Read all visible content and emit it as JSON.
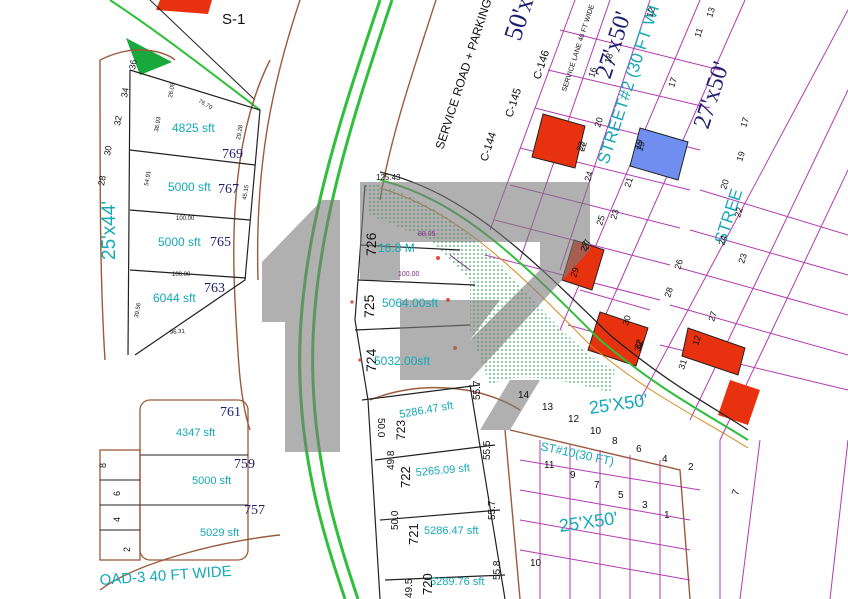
{
  "lots_left": [
    {
      "id": "769",
      "area": "4825 sft"
    },
    {
      "id": "767",
      "area": "5000 sft"
    },
    {
      "id": "765",
      "area": "5000 sft"
    },
    {
      "id": "763",
      "area": "6044 sft"
    }
  ],
  "lots_bottom_left": [
    {
      "id": "761",
      "area": "4347 sft"
    },
    {
      "id": "759",
      "area": "5000 sft"
    },
    {
      "id": "757",
      "area": "5029 sft"
    }
  ],
  "lots_center": [
    {
      "id": "726",
      "area": "16.8 M"
    },
    {
      "id": "725",
      "area": "5064.00sft"
    },
    {
      "id": "724",
      "area": "5032.00sft"
    },
    {
      "id": "723",
      "area": "5286.47 sft"
    },
    {
      "id": "722",
      "area": "5265.09 sft"
    },
    {
      "id": "721",
      "area": "5286.47 sft"
    },
    {
      "id": "720",
      "area": "5289.76 sft"
    }
  ],
  "dims_center": {
    "top": "125.43",
    "mid_a": "88.05",
    "mid_b": "100.00",
    "d1": "55.7",
    "d2": "55.5",
    "d3": "55.7",
    "d4": "55.8",
    "l1": "50.0",
    "l2": "49.8",
    "l3": "50.0",
    "l4": "49.5"
  },
  "dims_left": [
    "29.28",
    "26.09",
    "38.93",
    "54.91",
    "45.15",
    "100.00",
    "100.00",
    "96.31",
    "39.56",
    "76.70"
  ],
  "labels": {
    "s1": "S-1",
    "service_road": "SERVICE ROAD + PARKING",
    "service_lane": "SERVICE LANE 40 FT WIDE",
    "c144": "C-144",
    "c145": "C-145",
    "c146": "C-146",
    "size_top": "50'x",
    "size_27_a": "27'x50'",
    "size_27_b": "27'x50'",
    "street2": "STREET#2 (30 FT WI",
    "street_right": "STREE",
    "size_left": "25'x44'",
    "size_25_a": "25'X50'",
    "size_25_b": "25'X50'",
    "st10": "ST#10(30 FT)",
    "road3": "OAD-3 40 FT WIDE",
    "ruler_left": [
      "36",
      "34",
      "32",
      "30",
      "28"
    ],
    "ruler_bottom": [
      "8",
      "6",
      "4",
      "2"
    ],
    "grid_left_col": [
      "14",
      "16",
      "18",
      "20",
      "22",
      "24",
      "25",
      "27",
      "29",
      "30",
      "32"
    ],
    "grid_mid_col": [
      "12",
      "15",
      "17",
      "19",
      "21",
      "23",
      "26",
      "28",
      "31"
    ],
    "grid_right_col": [
      "11",
      "13",
      "15",
      "17",
      "19",
      "20",
      "22",
      "24",
      "23",
      "27"
    ],
    "lower_row1": [
      "14",
      "13",
      "12",
      "10",
      "8",
      "6",
      "4",
      "2"
    ],
    "lower_row2": [
      "11",
      "9",
      "7",
      "5",
      "3",
      "1"
    ],
    "small_7": "7",
    "small_10": "10"
  },
  "colors": {
    "red_plot": "#e8320f",
    "blue_plot": "#6f8ef0",
    "green_road": "#2fbf3a",
    "green_patch": "#19a83c",
    "watermark": "#888888"
  }
}
